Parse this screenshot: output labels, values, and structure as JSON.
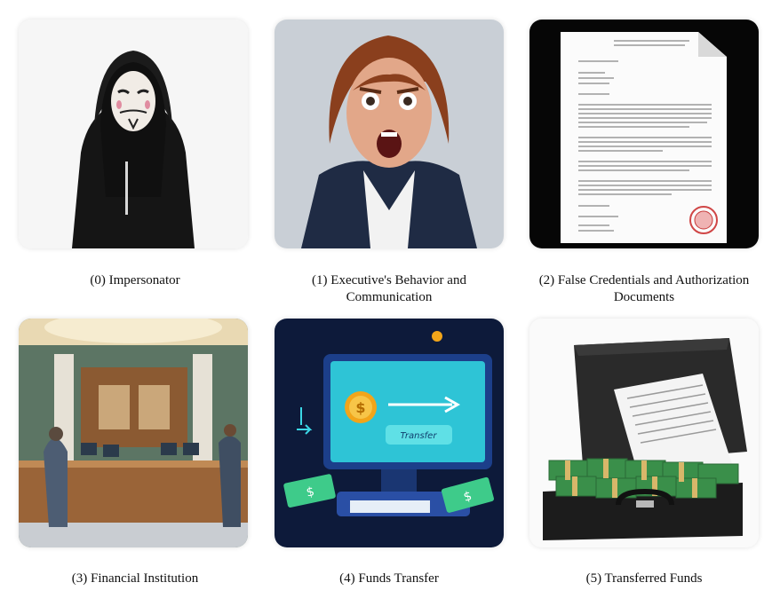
{
  "panels": [
    {
      "caption": "(0) Impersonator",
      "image": "hooded-masked-figure"
    },
    {
      "caption": "(1) Executive's Behavior and Communication",
      "image": "shocked-executive-woman"
    },
    {
      "caption": "(2) False Credentials and Authorization Documents",
      "image": "forged-document-with-seal"
    },
    {
      "caption": "(3) Financial Institution",
      "image": "bank-lobby-counter"
    },
    {
      "caption": "(4) Funds Transfer",
      "image": "computer-transfer-illustration",
      "button_label": "Transfer"
    },
    {
      "caption": "(5) Transferred Funds",
      "image": "briefcase-of-cash"
    }
  ],
  "colors": {
    "background": "#ffffff",
    "accent_teal": "#2ec4d6",
    "cash_green": "#3a8f4a"
  }
}
